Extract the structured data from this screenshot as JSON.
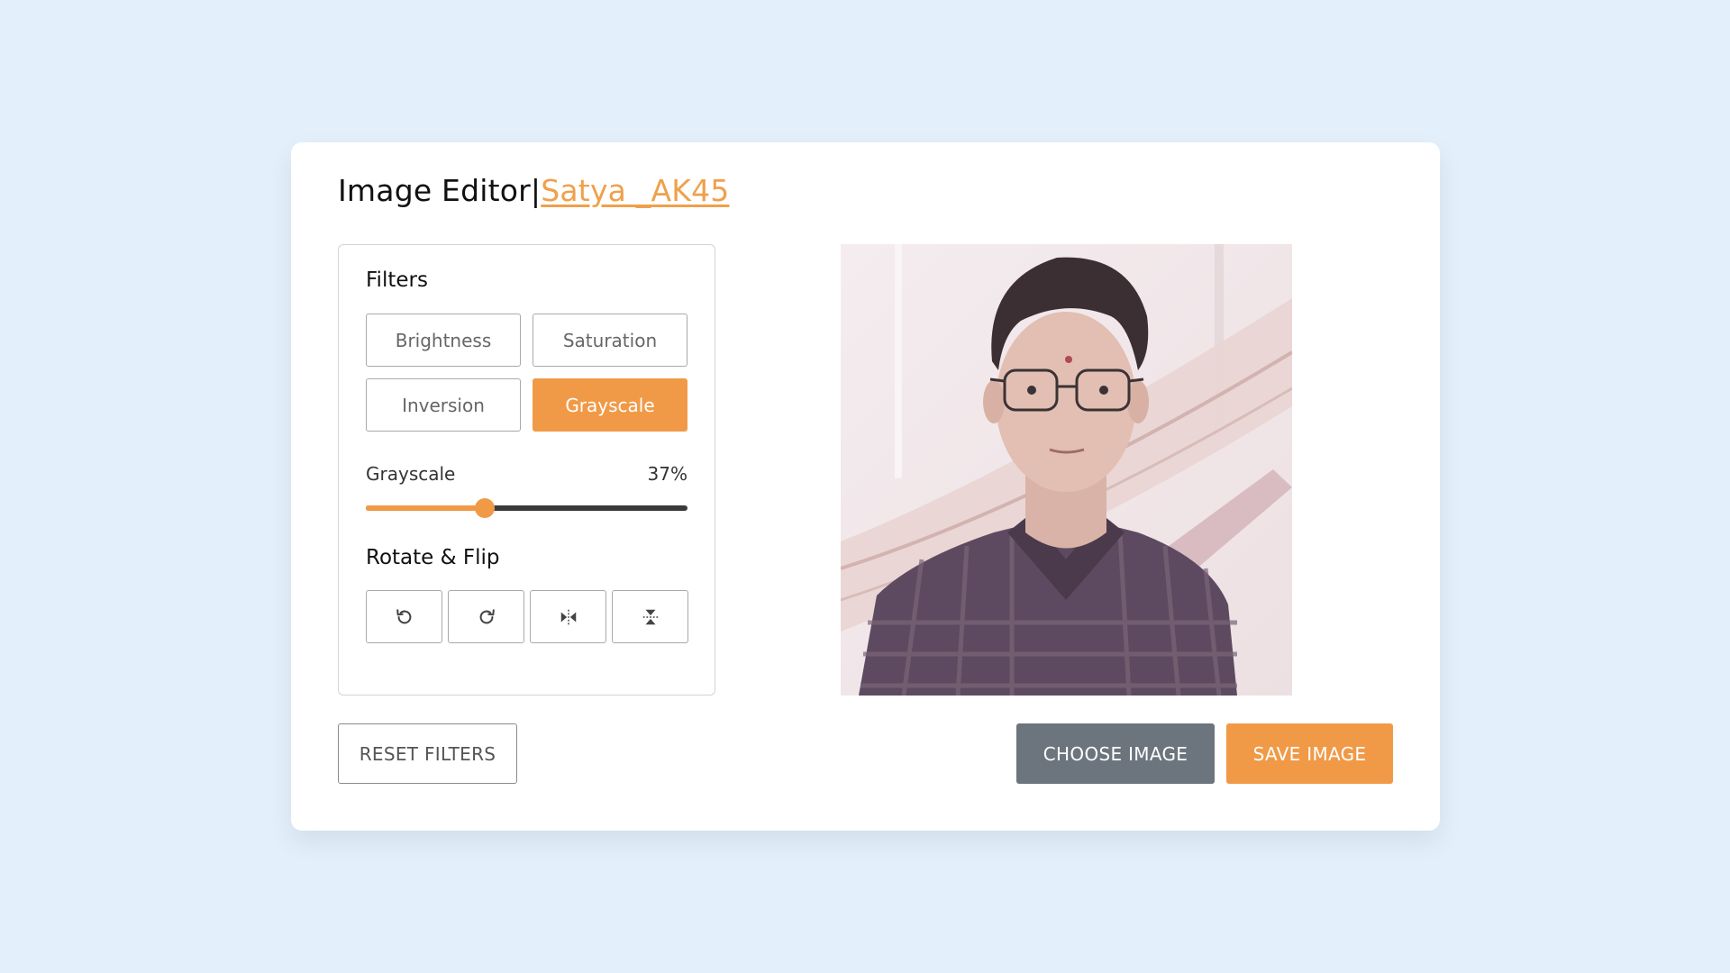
{
  "header": {
    "title": "Image Editor|",
    "author_link": "Satya _AK45"
  },
  "filters": {
    "section_title": "Filters",
    "buttons": [
      {
        "label": "Brightness",
        "active": false
      },
      {
        "label": "Saturation",
        "active": false
      },
      {
        "label": "Inversion",
        "active": false
      },
      {
        "label": "Grayscale",
        "active": true
      }
    ],
    "slider": {
      "label": "Grayscale",
      "value_text": "37%",
      "value": 37
    }
  },
  "rotate_flip": {
    "section_title": "Rotate & Flip",
    "buttons": [
      {
        "icon": "rotate-left-icon"
      },
      {
        "icon": "rotate-right-icon"
      },
      {
        "icon": "flip-horizontal-icon"
      },
      {
        "icon": "flip-vertical-icon"
      }
    ]
  },
  "actions": {
    "reset": "RESET FILTERS",
    "choose": "CHOOSE IMAGE",
    "save": "SAVE IMAGE"
  },
  "colors": {
    "accent": "#f09a47",
    "background": "#e3f0fc",
    "choose_button": "#6c757d"
  }
}
